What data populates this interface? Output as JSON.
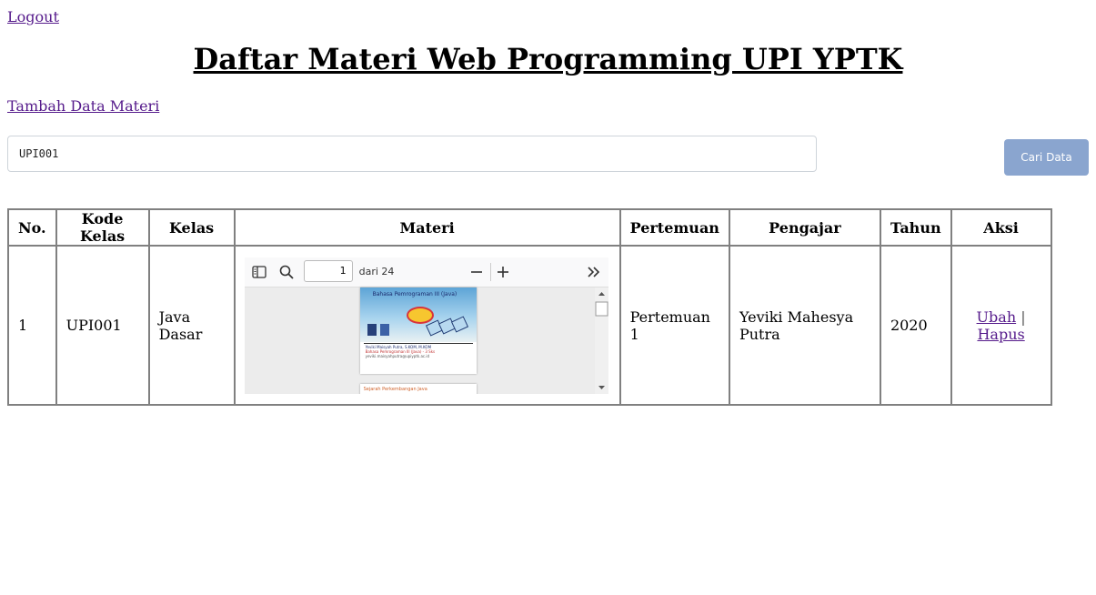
{
  "logout_label": "Logout",
  "page_title": "Daftar Materi Web Programming UPI YPTK",
  "add_link_label": "Tambah Data Materi",
  "search": {
    "value": "UPI001",
    "button_label": "Cari Data"
  },
  "table": {
    "headers": [
      "No.",
      "Kode Kelas",
      "Kelas",
      "Materi",
      "Pertemuan",
      "Pengajar",
      "Tahun",
      "Aksi"
    ],
    "rows": [
      {
        "no": "1",
        "kode_kelas": "UPI001",
        "kelas": "Java Dasar",
        "pertemuan": "Pertemuan 1",
        "pengajar": "Yeviki Mahesya Putra",
        "tahun": "2020",
        "edit_label": "Ubah",
        "separator": "|",
        "delete_label": "Hapus"
      }
    ]
  },
  "pdf_viewer": {
    "page": "1",
    "total_label": "dari 24",
    "page1_title": "Bahasa Pemrograman III (Java)",
    "page1_author": "Yeviki Maisyah Putra, S.KOM, M.KOM",
    "page1_subtitle": "Bahasa Pemrograman III (Java) - 3 Sks",
    "page1_email": "yeviki.maisyahputra@upiyptk.ac.id",
    "page2_title": "Sejarah Perkembangan Java"
  },
  "colors": {
    "link": "#551a8b",
    "button": "#8aa5cf"
  }
}
